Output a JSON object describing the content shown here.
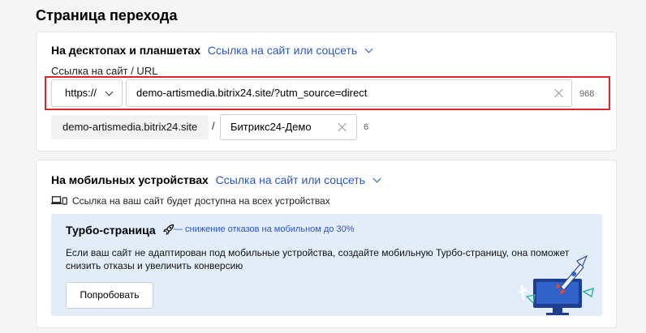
{
  "page": {
    "title": "Страница перехода"
  },
  "desktop": {
    "heading": "На десктопах и планшетах",
    "link_mode": "Ссылка на сайт или соцсеть",
    "url_label": "Ссылка на сайт / URL",
    "protocol": "https://",
    "url_value": "demo-artismedia.bitrix24.site/?utm_source=direct",
    "url_counter": "968",
    "domain": "demo-artismedia.bitrix24.site",
    "slash": "/",
    "path_value": "Битрикс24-Демо",
    "path_counter": "6"
  },
  "mobile": {
    "heading": "На мобильных устройствах",
    "link_mode": "Ссылка на сайт или соцсеть",
    "note": "Ссылка на ваш сайт будет доступна на всех устройствах",
    "turbo": {
      "title": "Турбо-страница",
      "tagline": "— снижение отказов на мобильном до 30%",
      "text": "Если ваш сайт не адаптирован под мобильные устройства, создайте мобильную Турбо-страницу, она поможет снизить отказы и увеличить конверсию",
      "button": "Попробовать"
    }
  },
  "colors": {
    "accent_link": "#2a55c4",
    "highlight_border": "#d9272e",
    "turbo_bg": "#e3edfa"
  },
  "icons": [
    "chevron-down-icon",
    "clear-icon",
    "laptop-phone-icon",
    "rocket-icon"
  ]
}
